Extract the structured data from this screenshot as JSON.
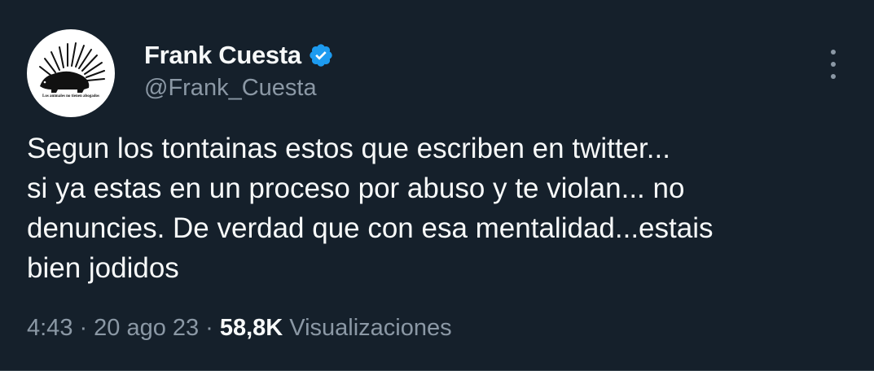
{
  "author": {
    "display_name": "Frank Cuesta",
    "handle": "@Frank_Cuesta",
    "verified": true,
    "avatar_caption": "Los animales no tienen abogados"
  },
  "tweet": {
    "text_lines": [
      "Segun los tontainas estos que escriben en twitter...",
      "si ya estas en un proceso por abuso y te violan... no",
      "denuncies. De verdad que con esa mentalidad...estais",
      "bien jodidos"
    ]
  },
  "meta": {
    "time": "4:43",
    "separator": "·",
    "date": "20 ago 23",
    "views_count": "58,8K",
    "views_label": "Visualizaciones"
  },
  "icons": {
    "verified": "verified-badge-icon",
    "more": "more-options-icon"
  },
  "colors": {
    "background": "#15202b",
    "primary_text": "#f7f9f9",
    "secondary_text": "#8b98a5",
    "verified_blue": "#1d9bf0"
  }
}
